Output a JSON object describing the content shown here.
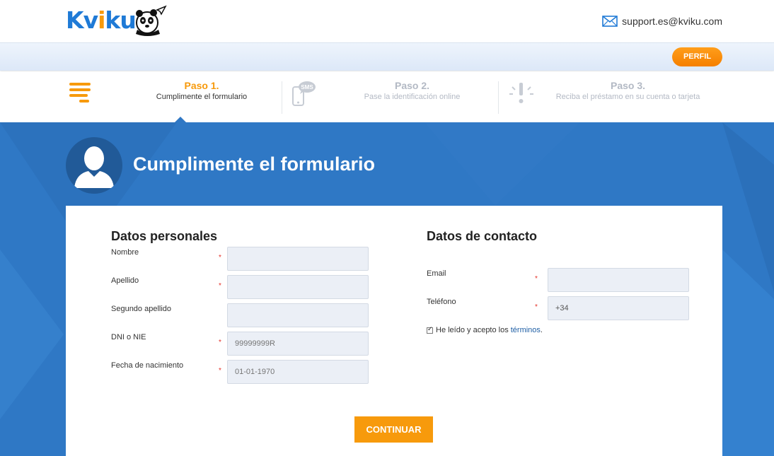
{
  "header": {
    "logo": {
      "part1": "Kv",
      "part2": "i",
      "part3": "ku"
    },
    "support_email": "support.es@kviku.com",
    "profile_button": "PERFIL"
  },
  "steps": [
    {
      "title": "Paso 1.",
      "subtitle": "Cumplimente el formulario",
      "active": true
    },
    {
      "title": "Paso 2.",
      "subtitle": "Pase la identificación online",
      "active": false
    },
    {
      "title": "Paso 3.",
      "subtitle": "Reciba el préstamo en su cuenta o tarjeta",
      "active": false
    }
  ],
  "sms_icon_text": "SMS",
  "page": {
    "title": "Cumplimente el formulario"
  },
  "personal": {
    "title": "Datos personales",
    "fields": [
      {
        "label": "Nombre",
        "required": "*",
        "value": ""
      },
      {
        "label": "Apellido",
        "required": "*",
        "value": ""
      },
      {
        "label": "Segundo apellido",
        "required": "",
        "value": ""
      },
      {
        "label": "DNI o NIE",
        "required": "*",
        "value": "",
        "placeholder": "99999999R"
      },
      {
        "label": "Fecha de nacimiento",
        "required": "*",
        "value": "",
        "placeholder": "01-01-1970"
      }
    ]
  },
  "contact": {
    "title": "Datos de contacto",
    "fields": [
      {
        "label": "Email",
        "required": "*",
        "value": ""
      },
      {
        "label": "Teléfono",
        "required": "*",
        "value": "+34"
      }
    ],
    "terms_text": "He leído y acepto los",
    "terms_link": "términos",
    "terms_end": ".",
    "terms_checked": true
  },
  "continue_button": "CONTINUAR",
  "colors": {
    "brand_blue": "#2f78c5",
    "accent_orange": "#f79a0c"
  }
}
